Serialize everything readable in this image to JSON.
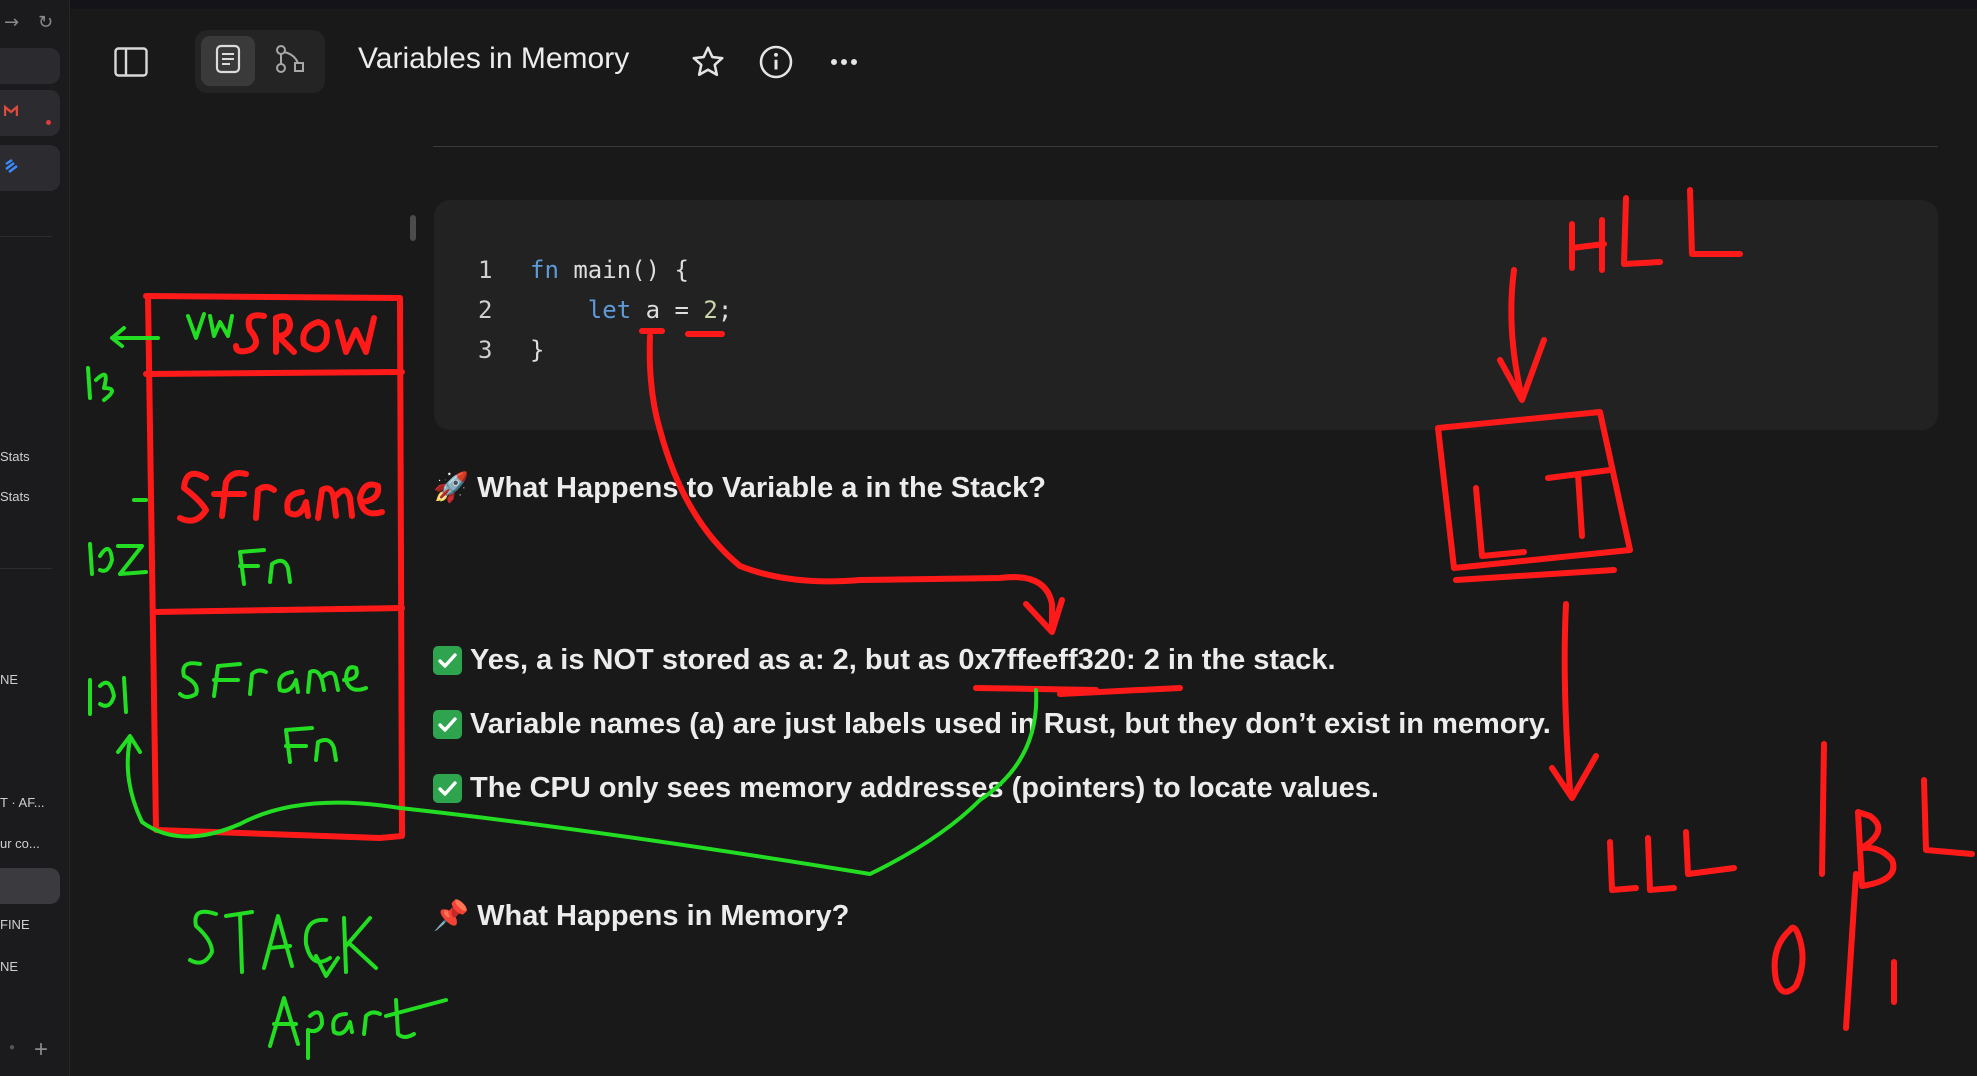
{
  "sidebar": {
    "items": [
      {
        "label": "Stats"
      },
      {
        "label": "Stats"
      },
      {
        "label": "NE"
      },
      {
        "label": "T · AF..."
      },
      {
        "label": "ur co..."
      },
      {
        "label": "FINE"
      },
      {
        "label": "NE"
      }
    ],
    "icons": [
      "arrow-right-icon",
      "refresh-icon",
      "gmail-icon",
      "app-icon",
      "plus-icon"
    ]
  },
  "header": {
    "title": "Variables in Memory"
  },
  "code": {
    "lines": [
      {
        "num": "1",
        "parts": [
          {
            "t": "fn",
            "c": "kw"
          },
          {
            "t": " main() {",
            "c": "fnname"
          }
        ]
      },
      {
        "num": "2",
        "parts": [
          {
            "t": "    let",
            "c": "kw"
          },
          {
            "t": " a = ",
            "c": "fnname"
          },
          {
            "t": "2",
            "c": "num"
          },
          {
            "t": ";",
            "c": "fnname"
          }
        ]
      },
      {
        "num": "3",
        "parts": [
          {
            "t": "}",
            "c": "fnname"
          }
        ]
      }
    ]
  },
  "content": {
    "heading1": {
      "emoji": "🚀",
      "text": "What Happens to Variable a in the Stack?"
    },
    "checks": [
      "Yes, a is NOT stored as a: 2, but as 0x7ffeeff320: 2 in the stack.",
      "Variable names (a) are just labels used in Rust, but they don’t exist in memory.",
      "The CPU only sees memory addresses (pointers) to locate values."
    ],
    "heading2": {
      "emoji": "📌",
      "text": "What Happens in Memory?"
    }
  },
  "annotations": {
    "red": [
      "SROW",
      "SFrame",
      "HLL",
      "LT",
      "LLL",
      "BL",
      "0|1"
    ],
    "green": [
      "vars",
      "103",
      "102",
      "101",
      "Fn",
      "SFram",
      "Fn",
      "STACK",
      "Apart"
    ]
  },
  "colors": {
    "background": "#191919",
    "codeblock": "#222222",
    "annotation_red": "#ff1a1a",
    "annotation_green": "#22dd22",
    "check_green": "#2ea44f"
  }
}
